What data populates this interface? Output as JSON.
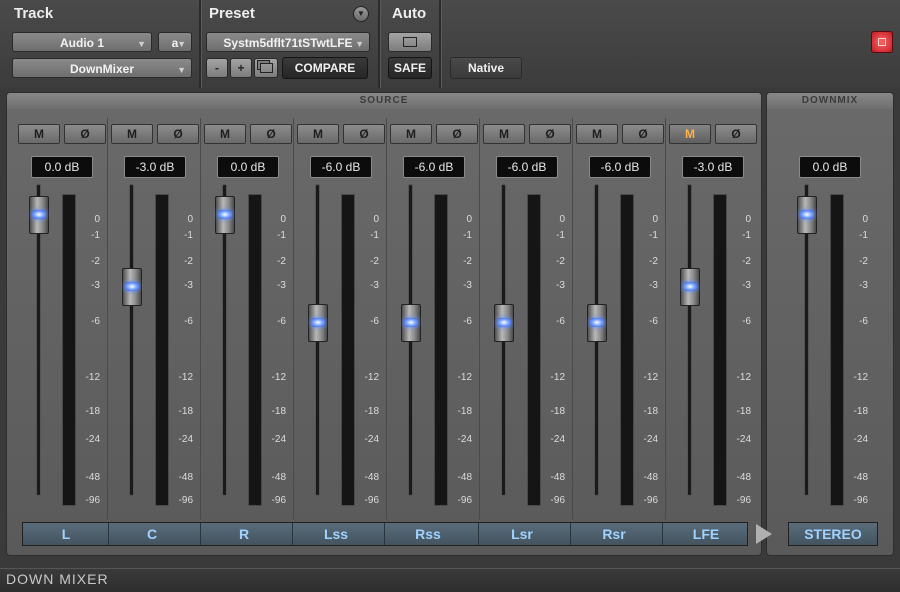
{
  "header": {
    "track": {
      "title": "Track",
      "track_select": "Audio 1",
      "channel_select": "a",
      "plugin_select": "DownMixer"
    },
    "preset": {
      "title": "Preset",
      "preset_name": "Systm5dflt71tSTwtLFE",
      "minus_label": "-",
      "plus_label": "+",
      "compare_label": "COMPARE"
    },
    "auto": {
      "title": "Auto",
      "safe_label": "SAFE",
      "native_label": "Native"
    },
    "colors": {
      "power_red": "#e0303a"
    }
  },
  "source": {
    "title": "SOURCE",
    "channels": [
      {
        "name": "L",
        "mute": "M",
        "phase": "Ø",
        "gain": "0.0 dB",
        "mute_on": false
      },
      {
        "name": "C",
        "mute": "M",
        "phase": "Ø",
        "gain": "-3.0 dB",
        "mute_on": false
      },
      {
        "name": "R",
        "mute": "M",
        "phase": "Ø",
        "gain": "0.0 dB",
        "mute_on": false
      },
      {
        "name": "Lss",
        "mute": "M",
        "phase": "Ø",
        "gain": "-6.0 dB",
        "mute_on": false
      },
      {
        "name": "Rss",
        "mute": "M",
        "phase": "Ø",
        "gain": "-6.0 dB",
        "mute_on": false
      },
      {
        "name": "Lsr",
        "mute": "M",
        "phase": "Ø",
        "gain": "-6.0 dB",
        "mute_on": false
      },
      {
        "name": "Rsr",
        "mute": "M",
        "phase": "Ø",
        "gain": "-6.0 dB",
        "mute_on": false
      },
      {
        "name": "LFE",
        "mute": "M",
        "phase": "Ø",
        "gain": "-3.0 dB",
        "mute_on": true
      }
    ]
  },
  "downmix": {
    "title": "DOWNMIX",
    "gain": "0.0 dB",
    "output_name": "STEREO"
  },
  "meter_scale": [
    "0",
    "-1",
    "-2",
    "-3",
    "-6",
    "-12",
    "-18",
    "-24",
    "-48",
    "-96"
  ],
  "footer": {
    "plugin_name": "DOWN MIXER"
  }
}
